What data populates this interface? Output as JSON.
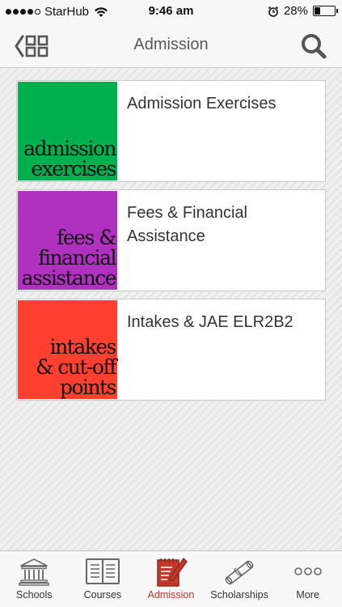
{
  "status_bar": {
    "carrier": "StarHub",
    "time": "9:46 am",
    "battery": "28%",
    "battery_level": 0.28
  },
  "nav": {
    "title": "Admission",
    "left_icon": "back-grid-icon",
    "right_icon": "search-icon"
  },
  "cards": [
    {
      "title": "Admission Exercises",
      "thumb_lines": [
        "admission",
        "exercises"
      ],
      "color": "#00b04f"
    },
    {
      "title": "Fees & Financial Assistance",
      "thumb_lines": [
        "fees &",
        "financial",
        "assistance"
      ],
      "color": "#b030c0"
    },
    {
      "title": "Intakes & JAE ELR2B2",
      "thumb_lines": [
        "intakes",
        "& cut-off",
        "points"
      ],
      "color": "#ff4030"
    }
  ],
  "tabs": [
    {
      "label": "Schools",
      "icon": "bank-icon",
      "active": false
    },
    {
      "label": "Courses",
      "icon": "book-icon",
      "active": false
    },
    {
      "label": "Admission",
      "icon": "notepad-pencil-icon",
      "active": true
    },
    {
      "label": "Scholarships",
      "icon": "diploma-icon",
      "active": false
    },
    {
      "label": "More",
      "icon": "more-dots-icon",
      "active": false
    }
  ],
  "colors": {
    "accent": "#c0392b",
    "icon_gray": "#666666"
  }
}
